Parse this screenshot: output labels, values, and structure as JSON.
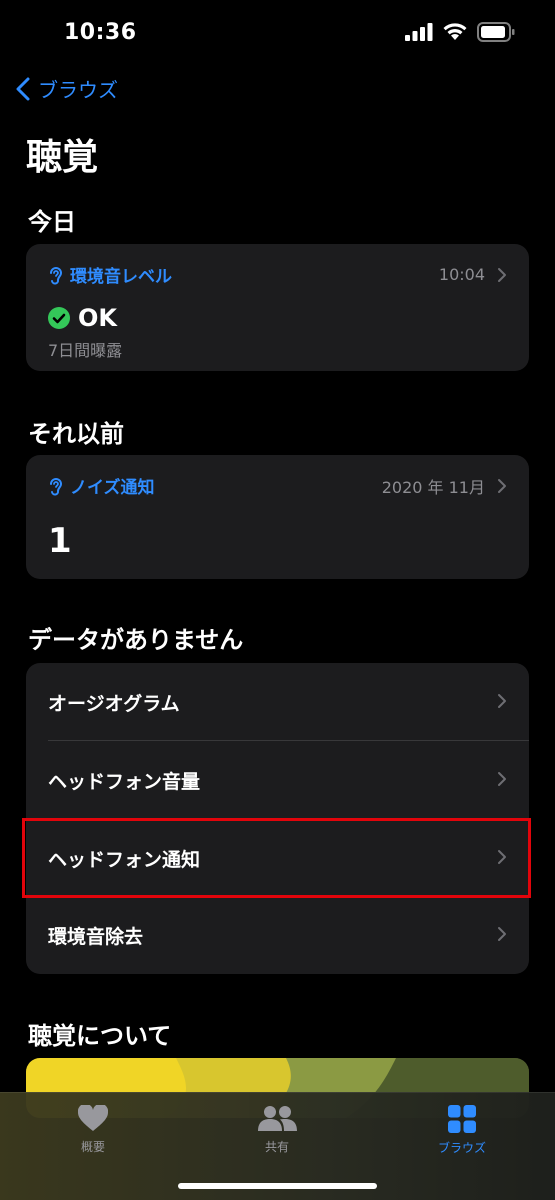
{
  "status_bar": {
    "time": "10:36"
  },
  "nav": {
    "back_label": "ブラウズ",
    "title": "聴覚"
  },
  "sections": {
    "today": "今日",
    "earlier": "それ以前",
    "no_data": "データがありません",
    "about": "聴覚について"
  },
  "env_card": {
    "label": "環境音レベル",
    "time": "10:04",
    "status": "OK",
    "subtitle": "7日間曝露"
  },
  "noise_card": {
    "label": "ノイズ通知",
    "date": "2020 年 11月",
    "value": "1"
  },
  "no_data_items": [
    {
      "label": "オージオグラム"
    },
    {
      "label": "ヘッドフォン音量"
    },
    {
      "label": "ヘッドフォン通知"
    },
    {
      "label": "環境音除去"
    }
  ],
  "tabs": [
    {
      "label": "概要",
      "icon": "heart-icon"
    },
    {
      "label": "共有",
      "icon": "people-icon"
    },
    {
      "label": "ブラウズ",
      "icon": "grid-icon"
    }
  ],
  "colors": {
    "accent": "#2f8cff",
    "card_bg": "#1c1c1e",
    "ok_green": "#34c759",
    "highlight": "#e2040b"
  }
}
